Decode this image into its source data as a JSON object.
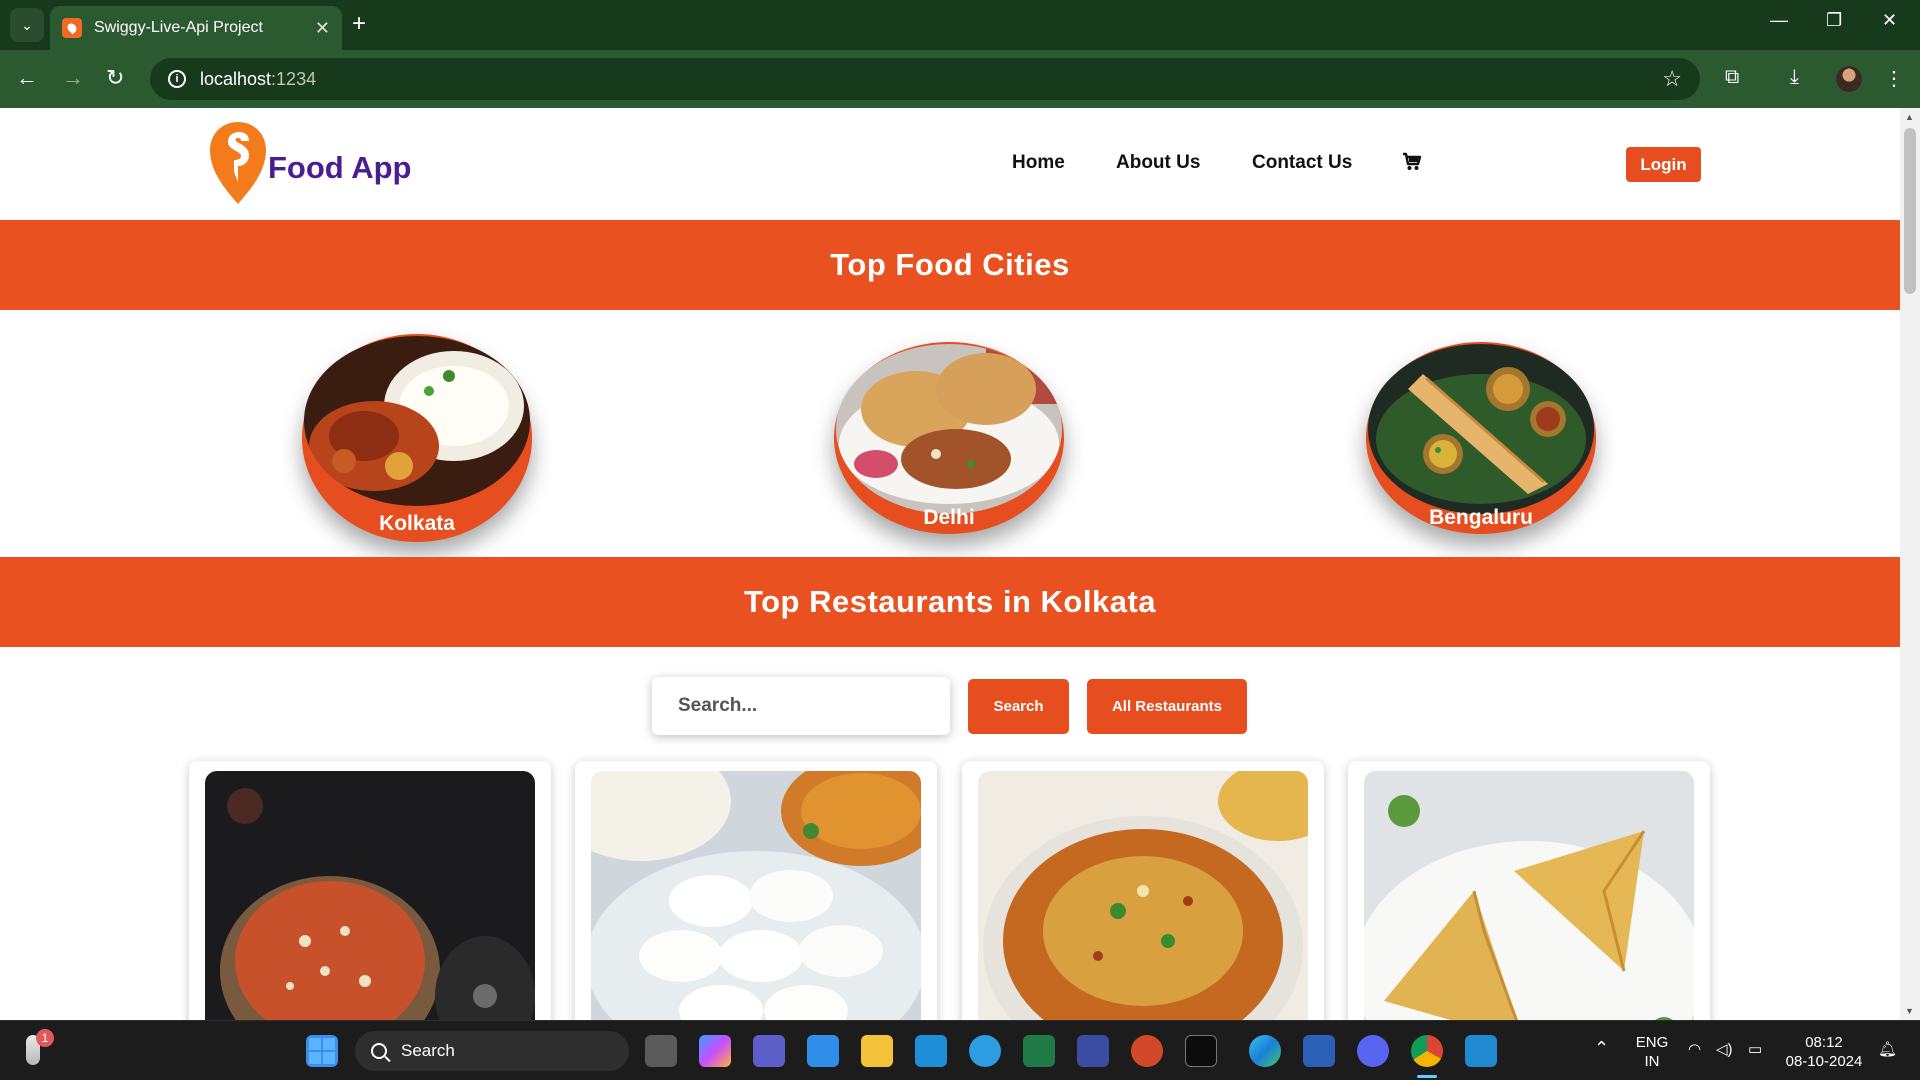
{
  "browser": {
    "tab_title": "Swiggy-Live-Api Project",
    "address_host": "localhost",
    "address_port": ":1234",
    "accent": "#2b5a31"
  },
  "header": {
    "logo_text": "Food App",
    "nav": [
      "Home",
      "About Us",
      "Contact Us"
    ],
    "cart_icon": "cart-icon",
    "login_label": "Login"
  },
  "cities_section": {
    "title": "Top Food Cities",
    "cities": [
      "Kolkata",
      "Delhi",
      "Bengaluru"
    ]
  },
  "restaurants_section": {
    "title": "Top Restaurants in Kolkata",
    "search_placeholder": "Search...",
    "search_button": "Search",
    "all_button": "All Restaurants"
  },
  "taskbar": {
    "search_label": "Search",
    "notification_badge": "1",
    "language": "ENG",
    "region": "IN",
    "time": "08:12",
    "date": "08-10-2024"
  },
  "colors": {
    "brand_orange": "#e95220",
    "brand_purple": "#4b1d91"
  }
}
